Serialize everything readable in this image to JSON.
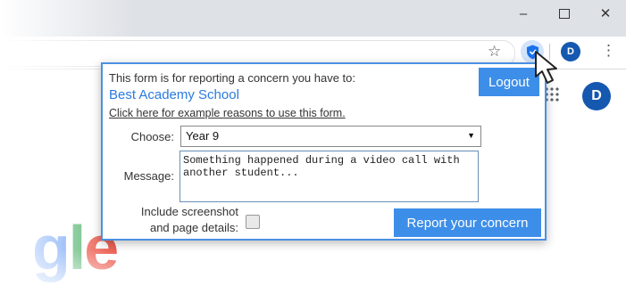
{
  "browser": {
    "window_controls": {
      "minimize": "–",
      "close": "✕"
    },
    "bookmark_icon": "star-icon",
    "extension_icon": "shield-icon",
    "profile_initial": "D",
    "menu_icon": "⋮"
  },
  "page": {
    "avatar_initial": "D",
    "logo_letters": {
      "g": "g",
      "l": "l",
      "e": "e"
    }
  },
  "popup": {
    "intro": "This form is for reporting a concern you have to:",
    "school_name": "Best Academy School",
    "example_link": "Click here for example reasons to use this form.",
    "logout_label": "Logout",
    "choose_label": "Choose:",
    "choose_value": "Year 9",
    "message_label": "Message:",
    "message_value": "Something happened during a video call with\nanother student...",
    "screenshot_label_line1": "Include screenshot",
    "screenshot_label_line2": "and page details:",
    "screenshot_checked": false,
    "report_label": "Report your concern"
  },
  "colors": {
    "accent": "#3d8ee8",
    "school_text": "#2a7be0",
    "popup_border": "#4a90e2",
    "profile": "#1558b0"
  }
}
